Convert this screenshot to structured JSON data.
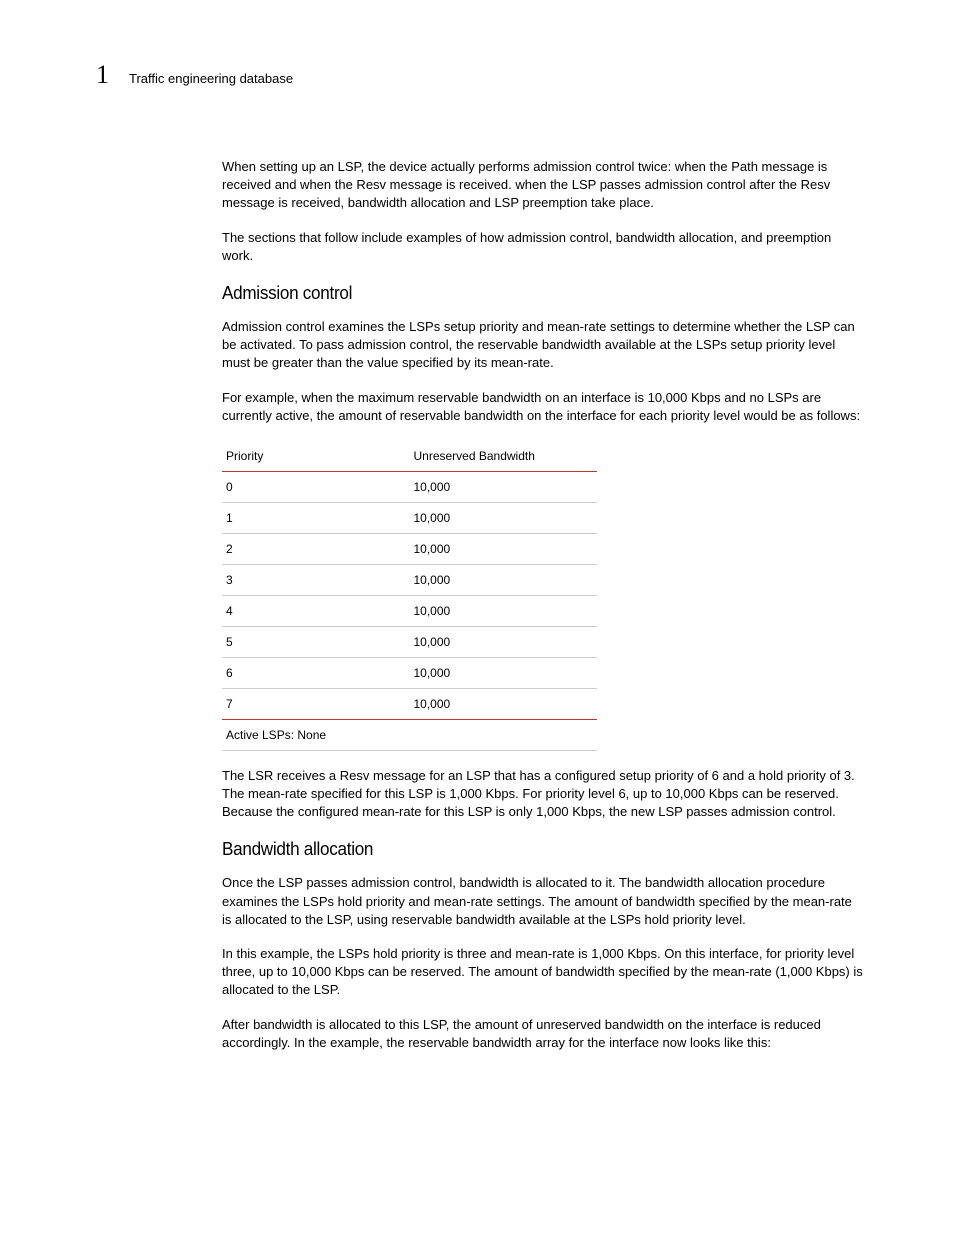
{
  "header": {
    "chapter_number": "1",
    "chapter_title": "Traffic engineering database"
  },
  "body": {
    "p1": "When setting up an LSP, the device actually performs admission control twice: when the Path message is received and when the Resv message is received. when the LSP passes admission control after the Resv message is received, bandwidth allocation and LSP preemption take place.",
    "p2": "The sections that follow include examples of how admission control, bandwidth allocation, and preemption work.",
    "h_admission": "Admission control",
    "p3": "Admission control examines the LSPs setup priority and mean-rate settings to determine whether the LSP can be activated. To pass admission control, the reservable bandwidth available at the LSPs setup priority level must be greater than the value specified by its mean-rate.",
    "p4": "For example, when the maximum reservable bandwidth on an interface is 10,000 Kbps and no LSPs are currently active, the amount of reservable bandwidth on the interface for each priority level would be as follows:",
    "table": {
      "headers": {
        "c0": "Priority",
        "c1": "Unreserved Bandwidth"
      },
      "rows": [
        {
          "c0": "0",
          "c1": "10,000"
        },
        {
          "c0": "1",
          "c1": "10,000"
        },
        {
          "c0": "2",
          "c1": "10,000"
        },
        {
          "c0": "3",
          "c1": "10,000"
        },
        {
          "c0": "4",
          "c1": "10,000"
        },
        {
          "c0": "5",
          "c1": "10,000"
        },
        {
          "c0": "6",
          "c1": "10,000"
        },
        {
          "c0": "7",
          "c1": "10,000"
        }
      ],
      "footer": "Active LSPs: None"
    },
    "p5": "The LSR receives a Resv message for an LSP that has a configured setup priority of 6 and a hold priority of 3. The mean-rate specified for this LSP is 1,000 Kbps. For priority level 6, up to 10,000 Kbps can be reserved. Because the configured mean-rate for this LSP is only 1,000 Kbps, the new LSP passes admission control.",
    "h_bandwidth": "Bandwidth allocation",
    "p6": "Once the LSP passes admission control, bandwidth is allocated to it. The bandwidth allocation procedure examines the LSPs hold priority and mean-rate settings. The amount of bandwidth specified by the mean-rate is allocated to the LSP, using reservable bandwidth available at the LSPs hold priority level.",
    "p7": "In this example, the LSPs hold priority is three and mean-rate is 1,000 Kbps. On this interface, for priority level three, up to 10,000 Kbps can be reserved. The amount of bandwidth specified by the mean-rate (1,000 Kbps) is allocated to the LSP.",
    "p8": "After bandwidth is allocated to this LSP, the amount of unreserved bandwidth on the interface is reduced accordingly. In the example, the reservable bandwidth array for the interface now looks like this:"
  }
}
